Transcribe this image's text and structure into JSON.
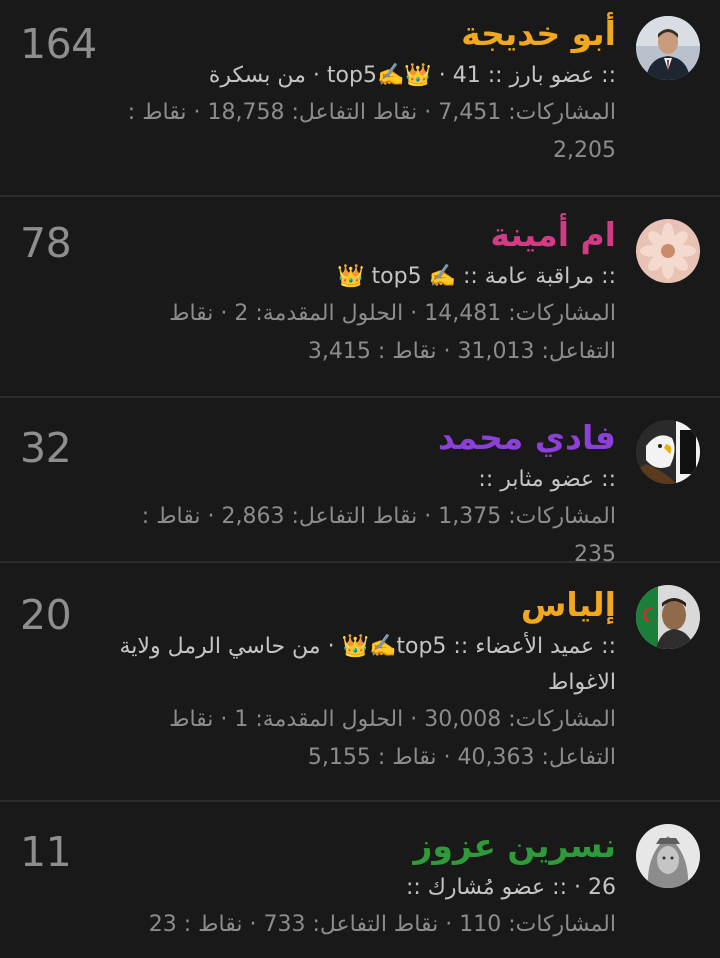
{
  "members": [
    {
      "count": "164",
      "name": "أبو خديجة",
      "name_color": "#f1a81e",
      "meta": ":: عضو بارز :: top5✍️👑 · 41 · من بسكرة",
      "stats": "المشاركات: 7,451 · نقاط التفاعل: 18,758 · نقاط : 2,205",
      "avatar_icon": "man-suit-avatar"
    },
    {
      "count": "78",
      "name": "ام أمينة",
      "name_color": "#d23b86",
      "meta": ":: مراقبة عامة :: ✍️ top5 👑",
      "stats": "المشاركات: 14,481 · الحلول المقدمة: 2 · نقاط التفاعل: 31,013 · نقاط : 3,415",
      "avatar_icon": "pink-flower-avatar"
    },
    {
      "count": "32",
      "name": "فادي محمد",
      "name_color": "#8c40d8",
      "meta": ":: عضو مثابر ::",
      "stats": "المشاركات: 1,375 · نقاط التفاعل: 2,863 · نقاط : 235",
      "avatar_icon": "eagle-avatar"
    },
    {
      "count": "20",
      "name": "إلياس",
      "name_color": "#f1a81e",
      "meta": ":: عميد الأعضاء :: top5✍️👑 · من حاسي الرمل ولاية الاغواط",
      "stats": "المشاركات: 30,008 · الحلول المقدمة: 1 · نقاط التفاعل: 40,363 · نقاط : 5,155",
      "avatar_icon": "man-flag-avatar"
    },
    {
      "count": "11",
      "name": "نسرين عزوز",
      "name_color": "#2e9a3a",
      "meta": "26 · :: عضو مُشارك ::",
      "stats": "المشاركات: 110 · نقاط التفاعل: 733 · نقاط : 23",
      "avatar_icon": "veiled-woman-avatar"
    }
  ]
}
